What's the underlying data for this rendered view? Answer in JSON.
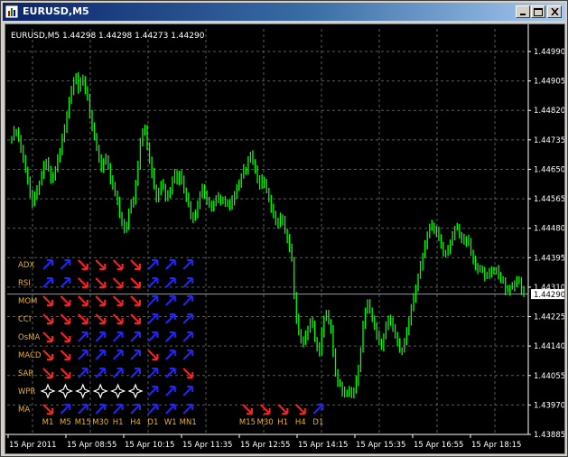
{
  "window": {
    "title": "EURUSD,M5",
    "buttons": [
      "minimize",
      "maximize",
      "close"
    ]
  },
  "chart": {
    "info": "EURUSD,M5  1.44298 1.44298 1.44273 1.44290",
    "current_price_label": "1.44290",
    "colors": {
      "background": "#000000",
      "grid": "#5a5a5a",
      "bars": "#00ff00",
      "price_line": "#7f9fbf",
      "up_arrow": "#2424ff",
      "down_arrow": "#ff2020",
      "label": "#e8b030",
      "neutral": "#ffffff",
      "axis_text": "#ffffff"
    }
  },
  "chart_data": {
    "type": "line",
    "title": "EURUSD,M5",
    "xlabel": "",
    "ylabel": "",
    "ylim": [
      1.43885,
      1.4499
    ],
    "grid": true,
    "y_ticks": [
      "1.44990",
      "1.44905",
      "1.44820",
      "1.44735",
      "1.44650",
      "1.44565",
      "1.44480",
      "1.44395",
      "1.44310",
      "1.44225",
      "1.44140",
      "1.44055",
      "1.43970",
      "1.43885"
    ],
    "x_ticks": [
      "15 Apr 2011",
      "15 Apr 08:55",
      "15 Apr 10:15",
      "15 Apr 11:35",
      "15 Apr 12:55",
      "15 Apr 14:15",
      "15 Apr 15:35",
      "15 Apr 16:55",
      "15 Apr 18:15"
    ],
    "series": [
      {
        "values": [
          1.4474,
          1.4476,
          1.4476,
          1.4474,
          1.4471,
          1.4468,
          1.4465,
          1.4462,
          1.4458,
          1.4455,
          1.4457,
          1.4459,
          1.4461,
          1.4463,
          1.4466,
          1.4467,
          1.4465,
          1.4462,
          1.4463,
          1.4465,
          1.4468,
          1.447,
          1.4474,
          1.4477,
          1.4481,
          1.4485,
          1.4488,
          1.4491,
          1.4492,
          1.4488,
          1.449,
          1.4491,
          1.4488,
          1.4486,
          1.4481,
          1.4477,
          1.4474,
          1.4471,
          1.4468,
          1.4465,
          1.4467,
          1.4468,
          1.4466,
          1.4462,
          1.446,
          1.4458,
          1.4456,
          1.4452,
          1.445,
          1.4448,
          1.4449,
          1.4453,
          1.4455,
          1.4456,
          1.4461,
          1.4466,
          1.4473,
          1.4476,
          1.4477,
          1.4472,
          1.4468,
          1.4464,
          1.446,
          1.4457,
          1.4459,
          1.4461,
          1.446,
          1.4457,
          1.4458,
          1.4459,
          1.4462,
          1.4464,
          1.4462,
          1.4464,
          1.4462,
          1.4459,
          1.4457,
          1.4455,
          1.4452,
          1.4451,
          1.4452,
          1.4455,
          1.4458,
          1.446,
          1.4458,
          1.4456,
          1.4455,
          1.4454,
          1.4455,
          1.4456,
          1.4457,
          1.4456,
          1.4456,
          1.4455,
          1.4455,
          1.4454,
          1.4456,
          1.4458,
          1.446,
          1.4461,
          1.4463,
          1.4465,
          1.4465,
          1.4468,
          1.4469,
          1.4467,
          1.4465,
          1.4462,
          1.446,
          1.4462,
          1.4461,
          1.4459,
          1.4457,
          1.4454,
          1.4452,
          1.445,
          1.4449,
          1.4451,
          1.445,
          1.4447,
          1.4445,
          1.4442,
          1.4439,
          1.4429,
          1.4422,
          1.4418,
          1.4416,
          1.4415,
          1.4417,
          1.4419,
          1.4421,
          1.442,
          1.4416,
          1.4414,
          1.4412,
          1.4418,
          1.4422,
          1.4423,
          1.4421,
          1.4419,
          1.4412,
          1.4406,
          1.4403,
          1.4403,
          1.4401,
          1.44,
          1.44,
          1.4401,
          1.44,
          1.4401,
          1.4404,
          1.4408,
          1.4413,
          1.442,
          1.4424,
          1.4426,
          1.4424,
          1.4422,
          1.442,
          1.4417,
          1.4415,
          1.4414,
          1.4417,
          1.442,
          1.4422,
          1.4421,
          1.4419,
          1.4417,
          1.4415,
          1.4413,
          1.4413,
          1.4415,
          1.4418,
          1.4421,
          1.4425,
          1.4428,
          1.4431,
          1.4434,
          1.4437,
          1.444,
          1.4443,
          1.4446,
          1.4448,
          1.4449,
          1.4448,
          1.4447,
          1.4445,
          1.4443,
          1.4441,
          1.4441,
          1.4442,
          1.4444,
          1.4446,
          1.4448,
          1.4448,
          1.4446,
          1.4445,
          1.4444,
          1.4445,
          1.4444,
          1.4441,
          1.4439,
          1.4437,
          1.4436,
          1.4436,
          1.4436,
          1.4434,
          1.4434,
          1.4435,
          1.4436,
          1.4436,
          1.4436,
          1.4434,
          1.4433,
          1.4433,
          1.443,
          1.443,
          1.4431,
          1.4431,
          1.4432,
          1.4433,
          1.4433,
          1.443,
          1.4429
        ]
      }
    ]
  },
  "indicator_panel": {
    "timeframes_left": [
      "M1",
      "M5",
      "M15",
      "M30",
      "H1",
      "H4",
      "D1",
      "W1",
      "MN1"
    ],
    "timeframes_right": [
      "M15",
      "M30",
      "H1",
      "H4",
      "D1"
    ],
    "rows": [
      {
        "label": "ADX",
        "signals": [
          "up",
          "up",
          "down",
          "down",
          "down",
          "down",
          "up",
          "up",
          "up"
        ]
      },
      {
        "label": "RSI",
        "signals": [
          "up",
          "up",
          "down",
          "down",
          "down",
          "down",
          "up",
          "up",
          "up"
        ]
      },
      {
        "label": "MOM",
        "signals": [
          "down",
          "down",
          "down",
          "down",
          "down",
          "down",
          "up",
          "up",
          "up"
        ]
      },
      {
        "label": "CCI",
        "signals": [
          "down",
          "down",
          "down",
          "down",
          "down",
          "down",
          "up",
          "up",
          "up"
        ]
      },
      {
        "label": "OsMA",
        "signals": [
          "down",
          "down",
          "up",
          "up",
          "up",
          "up",
          "up",
          "up",
          "up"
        ]
      },
      {
        "label": "MACD",
        "signals": [
          "down",
          "down",
          "up",
          "up",
          "up",
          "up",
          "down",
          "up",
          "up"
        ]
      },
      {
        "label": "SAR",
        "signals": [
          "down",
          "down",
          "up",
          "up",
          "up",
          "up",
          "up",
          "up",
          "down"
        ]
      },
      {
        "label": "WPR",
        "signals": [
          "neutral",
          "neutral",
          "neutral",
          "neutral",
          "neutral",
          "neutral",
          "up",
          "up",
          "up"
        ]
      },
      {
        "label": "MA",
        "signals": [
          "down",
          "up",
          "up",
          "up",
          "up",
          "up",
          "up",
          "up",
          "up"
        ]
      }
    ],
    "ma_right_signals": [
      "down",
      "down",
      "down",
      "down",
      "up"
    ]
  }
}
